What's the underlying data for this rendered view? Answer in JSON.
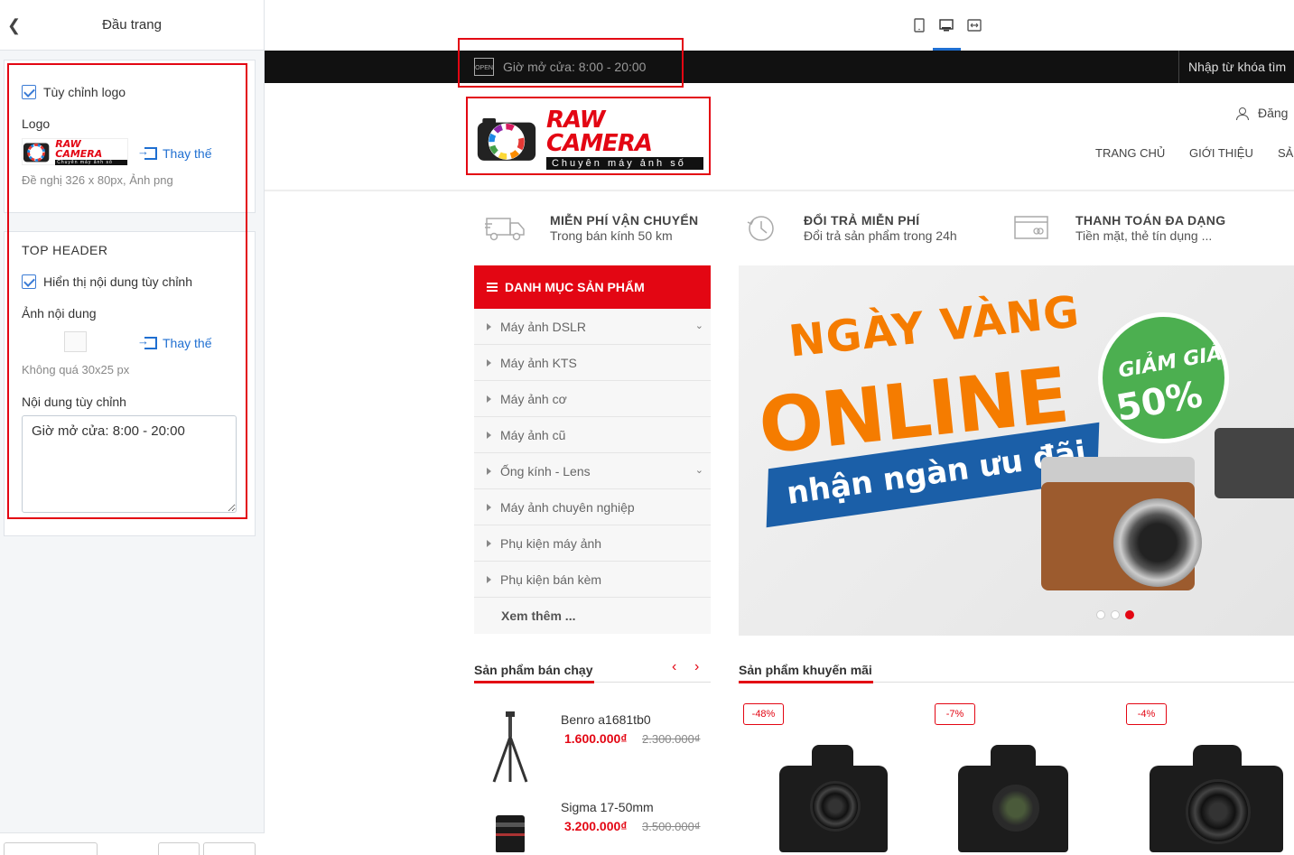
{
  "sidebar": {
    "title": "Đầu trang",
    "logo_section": {
      "custom_logo_label": "Tùy chỉnh logo",
      "logo_label": "Logo",
      "replace_label": "Thay thế",
      "logo_hint": "Đề nghị 326 x 80px, Ảnh png",
      "thumb_name": "RAW CAMERA",
      "thumb_sub": "Chuyên máy ảnh số"
    },
    "top_header": {
      "title": "TOP HEADER",
      "show_custom_label": "Hiển thị nội dung tùy chỉnh",
      "image_label": "Ảnh nội dung",
      "replace_label": "Thay thế",
      "image_hint": "Không quá 30x25 px",
      "content_label": "Nội dung tùy chỉnh",
      "content_value": "Giờ mở cửa: 8:00 - 20:00"
    }
  },
  "preview": {
    "topbar": {
      "open_icon": "OPEN",
      "hours": "Giờ mở cửa: 8:00 - 20:00",
      "search_placeholder": "Nhập từ khóa tìm"
    },
    "logo": {
      "name": "RAW CAMERA",
      "tagline": "Chuyên máy ảnh số"
    },
    "login": "Đăng",
    "nav": [
      "TRANG CHỦ",
      "GIỚI THIỆU",
      "SẢ"
    ],
    "features": [
      {
        "icon": "truck-icon",
        "title": "MIỄN PHÍ VẬN CHUYỂN",
        "sub": "Trong bán kính 50 km"
      },
      {
        "icon": "clock-icon",
        "title": "ĐỔI TRẢ MIỄN PHÍ",
        "sub": "Đổi trả sản phẩm trong 24h"
      },
      {
        "icon": "card-icon",
        "title": "THANH TOÁN ĐA DẠNG",
        "sub": "Tiền mặt, thẻ tín dụng ..."
      }
    ],
    "category": {
      "title": "DANH MỤC SẢN PHẨM",
      "items": [
        {
          "label": "Máy ảnh DSLR",
          "has_sub": true
        },
        {
          "label": "Máy ảnh KTS",
          "has_sub": false
        },
        {
          "label": "Máy ảnh cơ",
          "has_sub": false
        },
        {
          "label": "Máy ảnh cũ",
          "has_sub": false
        },
        {
          "label": "Ống kính - Lens",
          "has_sub": true
        },
        {
          "label": "Máy ảnh chuyên nghiệp",
          "has_sub": false
        },
        {
          "label": "Phụ kiện máy ảnh",
          "has_sub": false
        },
        {
          "label": "Phụ kiện bán kèm",
          "has_sub": false
        }
      ],
      "more": "Xem thêm ..."
    },
    "banner": {
      "line1": "NGÀY VÀNG",
      "line2": "ONLINE",
      "line3": "nhận ngàn ưu đãi",
      "badge_top": "GIẢM GIÁ",
      "badge_pct": "50%",
      "slides": 3,
      "active_slide": 3
    },
    "bestseller": {
      "title": "Sản phẩm bán chạy",
      "prev": "‹",
      "next": "›",
      "products": [
        {
          "name": "Benro a1681tb0",
          "price": "1.600.000₫",
          "old_price": "2.300.000₫"
        },
        {
          "name": "Sigma 17-50mm",
          "price": "3.200.000₫",
          "old_price": "3.500.000₫"
        }
      ]
    },
    "promo": {
      "title": "Sản phẩm khuyến mãi",
      "badges": [
        "-48%",
        "-7%",
        "-4%"
      ]
    }
  },
  "colors": {
    "accent": "#e30613",
    "link": "#1f6fd1",
    "topbar": "#111111"
  }
}
